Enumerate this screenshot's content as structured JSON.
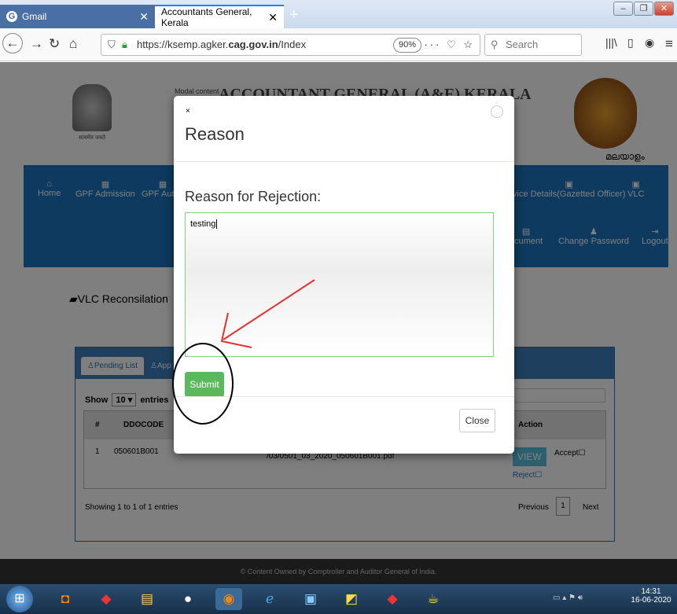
{
  "browser": {
    "tab1": "Gmail",
    "tab2": "Accountants General, Kerala",
    "url_pre": "https://ksemp.agker.",
    "url_bold": "cag.gov.in",
    "url_post": "/Index",
    "zoom": "90%",
    "search_placeholder": "Search"
  },
  "site": {
    "modal_content_tag": "Modal content",
    "header_title": "ACCOUNTANT GENERAL (A&E) KERALA",
    "emblem_caption": "सत्यमेव जयते",
    "language_link": "മലയാളം",
    "menu": [
      "Home",
      "GPF Admission",
      "GPF Autho",
      "vice Details(Gazetted Officer)",
      "VLC"
    ],
    "menu2": [
      "ocument",
      "Change Password",
      "Logout"
    ],
    "page_title": "VLC Reconsilation",
    "tab_pending": "Pending List",
    "tab_approved": "App",
    "show": "Show",
    "entries_count": "10",
    "entries": "entries",
    "columns": [
      "#",
      "DDOCODE",
      "Action"
    ],
    "row": {
      "num": "1",
      "ddocode": "050601B001",
      "file_a": "",
      "file_b": "/03/0501_03_2020_050601B001.pdf",
      "view": "VIEW",
      "accept": "Accept",
      "reject": "Reject"
    },
    "showing": "Showing 1 to 1 of 1 entries",
    "prev": "Previous",
    "page": "1",
    "next": "Next",
    "footer": "© Content Owned by Comptroller and Auditor General of India."
  },
  "modal": {
    "x": "×",
    "title": "Reason",
    "label": "Reason for Rejection:",
    "text": "testing",
    "submit": "Submit",
    "close": "Close"
  },
  "taskbar": {
    "time": "14:31",
    "date": "16-06-2020"
  },
  "colors": {
    "accent": "#1b75bc",
    "submit": "#5cb85c"
  }
}
